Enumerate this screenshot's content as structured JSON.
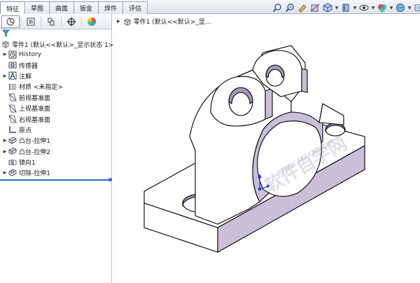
{
  "top_tabs": [
    {
      "label": "特征",
      "active": true
    },
    {
      "label": "草图",
      "active": false
    },
    {
      "label": "曲面",
      "active": false
    },
    {
      "label": "钣金",
      "active": false
    },
    {
      "label": "焊件",
      "active": false
    },
    {
      "label": "评估",
      "active": false
    }
  ],
  "hud_icons": [
    "zoom-to-fit-icon",
    "zoom-area-icon",
    "previous-view-icon",
    "section-view-icon",
    "view-orientation-icon",
    "display-style-icon",
    "hide-show-icon",
    "edit-appearance-icon",
    "apply-scene-icon",
    "view-settings-icon"
  ],
  "panel_tabs": [
    "featuremanager-icon",
    "propertymanager-icon",
    "configurationmanager-icon",
    "dimxpert-icon",
    "display-manager-icon"
  ],
  "tree": {
    "root": "零件1  (默认<<默认>_显示状态 1>)",
    "items": [
      {
        "label": "History",
        "icon": "history-icon",
        "expandable": true
      },
      {
        "label": "传感器",
        "icon": "sensors-icon",
        "expandable": false
      },
      {
        "label": "注解",
        "icon": "annotations-icon",
        "expandable": true
      },
      {
        "label": "材质 <未指定>",
        "icon": "material-icon",
        "expandable": false
      },
      {
        "label": "前视基准面",
        "icon": "plane-icon",
        "expandable": false
      },
      {
        "label": "上视基准面",
        "icon": "plane-icon",
        "expandable": false
      },
      {
        "label": "右视基准面",
        "icon": "plane-icon",
        "expandable": false
      },
      {
        "label": "原点",
        "icon": "origin-icon",
        "expandable": false
      },
      {
        "label": "凸台-拉伸1",
        "icon": "extrude-boss-icon",
        "expandable": true
      },
      {
        "label": "凸台-拉伸2",
        "icon": "extrude-boss-icon",
        "expandable": true
      },
      {
        "label": "镜向1",
        "icon": "mirror-icon",
        "expandable": false
      },
      {
        "label": "切除-拉伸1",
        "icon": "extrude-cut-icon",
        "expandable": true
      }
    ]
  },
  "graphics": {
    "title": "零件1  (默认<<默认>_显..."
  },
  "colors": {
    "model_face_light": "#ffffff",
    "model_face_shaded": "#c9bfd8",
    "model_edge": "#000000",
    "accent": "#2f66c9"
  }
}
